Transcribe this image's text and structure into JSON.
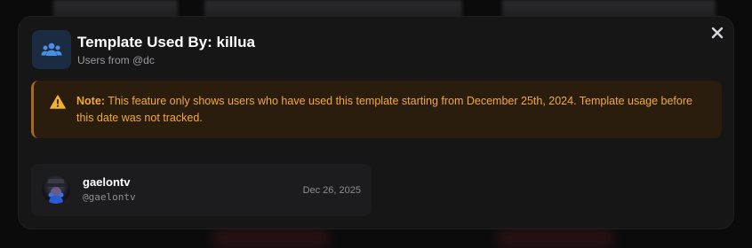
{
  "modal": {
    "title": "Template Used By: killua",
    "subtitle": "Users from @dc",
    "icon": "users-icon",
    "close_icon": "close-icon"
  },
  "note": {
    "label": "Note:",
    "text": " This feature only shows users who have used this template starting from December 25th, 2024. Template usage before this date was not tracked.",
    "icon": "warning-triangle-icon",
    "color": "#f2a93b"
  },
  "users": [
    {
      "name": "gaelontv",
      "handle": "@gaelontv",
      "date": "Dec 26, 2025"
    }
  ],
  "colors": {
    "accent": "#4a90e2",
    "warning": "#f2a93b",
    "modal_bg": "#161617"
  }
}
